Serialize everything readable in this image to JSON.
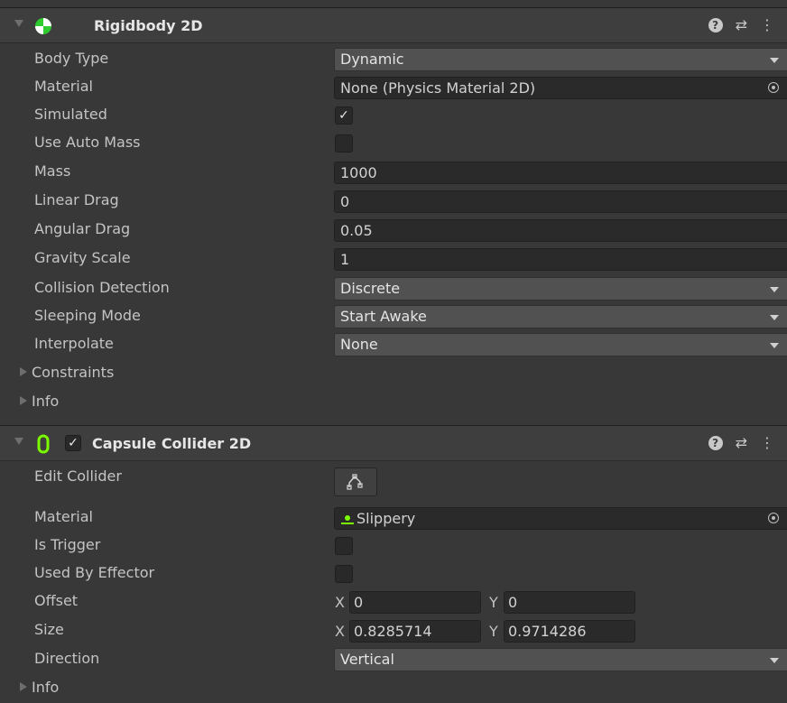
{
  "rigidbody": {
    "title": "Rigidbody 2D",
    "body_type": {
      "label": "Body Type",
      "value": "Dynamic"
    },
    "material": {
      "label": "Material",
      "value": "None (Physics Material 2D)"
    },
    "simulated": {
      "label": "Simulated",
      "checked": true,
      "mark": "✓"
    },
    "use_auto_mass": {
      "label": "Use Auto Mass",
      "checked": false
    },
    "mass": {
      "label": "Mass",
      "value": "1000"
    },
    "linear_drag": {
      "label": "Linear Drag",
      "value": "0"
    },
    "angular_drag": {
      "label": "Angular Drag",
      "value": "0.05"
    },
    "gravity_scale": {
      "label": "Gravity Scale",
      "value": "1"
    },
    "collision_detection": {
      "label": "Collision Detection",
      "value": "Discrete"
    },
    "sleeping_mode": {
      "label": "Sleeping Mode",
      "value": "Start Awake"
    },
    "interpolate": {
      "label": "Interpolate",
      "value": "None"
    },
    "constraints": {
      "label": "Constraints"
    },
    "info": {
      "label": "Info"
    }
  },
  "capsule": {
    "title": "Capsule Collider 2D",
    "enabled_mark": "✓",
    "edit_collider": {
      "label": "Edit Collider"
    },
    "material": {
      "label": "Material",
      "value": "Slippery"
    },
    "is_trigger": {
      "label": "Is Trigger",
      "checked": false
    },
    "used_by_effector": {
      "label": "Used By Effector",
      "checked": false
    },
    "offset": {
      "label": "Offset",
      "x_axis": "X",
      "x": "0",
      "y_axis": "Y",
      "y": "0"
    },
    "size": {
      "label": "Size",
      "x_axis": "X",
      "x": "0.8285714",
      "y_axis": "Y",
      "y": "0.9714286"
    },
    "direction": {
      "label": "Direction",
      "value": "Vertical"
    },
    "info": {
      "label": "Info"
    }
  },
  "header_icons": {
    "help": "?",
    "presets": "⇄",
    "menu": "⋮"
  },
  "colors": {
    "rigidbody_icon": "#2ecc2e",
    "capsule_icon": "#7cfc00",
    "background": "#383838"
  }
}
